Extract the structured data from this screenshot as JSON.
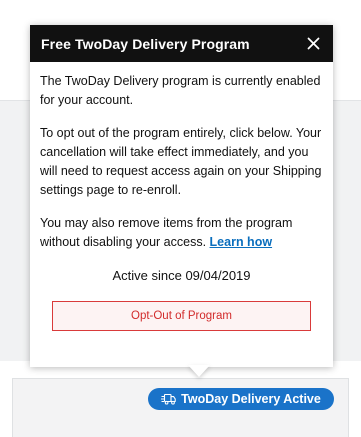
{
  "popover": {
    "title": "Free TwoDay Delivery Program",
    "close_icon": "close-icon",
    "paragraph1": "The TwoDay Delivery program is currently enabled for your account.",
    "paragraph2": "To opt out of the program entirely, click below. Your cancellation will take effect immediately, and you will need to request access again on your Shipping settings page to re-enroll.",
    "paragraph3_prefix": "You may also remove items from the program without disabling your access.",
    "learn_link": "Learn how",
    "active_since": "Active since 09/04/2019",
    "optout_label": "Opt-Out of Program"
  },
  "badge": {
    "icon": "delivery-truck-icon",
    "label": "TwoDay Delivery Active"
  },
  "colors": {
    "header_bg": "#111111",
    "link": "#0a6ebd",
    "optout_border": "#d93a3a",
    "optout_text": "#d22b2b",
    "badge_bg": "#1a73c9"
  }
}
